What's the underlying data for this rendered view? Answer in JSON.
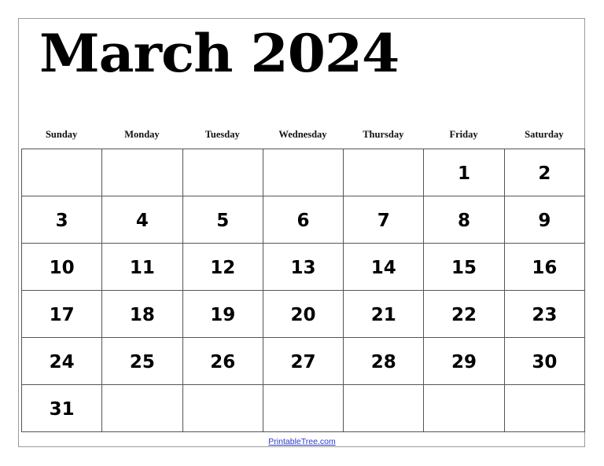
{
  "calendar": {
    "title": "March 2024",
    "weekdays": [
      "Sunday",
      "Monday",
      "Tuesday",
      "Wednesday",
      "Thursday",
      "Friday",
      "Saturday"
    ],
    "weeks": [
      [
        "",
        "",
        "",
        "",
        "",
        "1",
        "2"
      ],
      [
        "3",
        "4",
        "5",
        "6",
        "7",
        "8",
        "9"
      ],
      [
        "10",
        "11",
        "12",
        "13",
        "14",
        "15",
        "16"
      ],
      [
        "17",
        "18",
        "19",
        "20",
        "21",
        "22",
        "23"
      ],
      [
        "24",
        "25",
        "26",
        "27",
        "28",
        "29",
        "30"
      ],
      [
        "31",
        "",
        "",
        "",
        "",
        "",
        ""
      ]
    ]
  },
  "footer": {
    "link_text": "PrintableTree.com"
  }
}
